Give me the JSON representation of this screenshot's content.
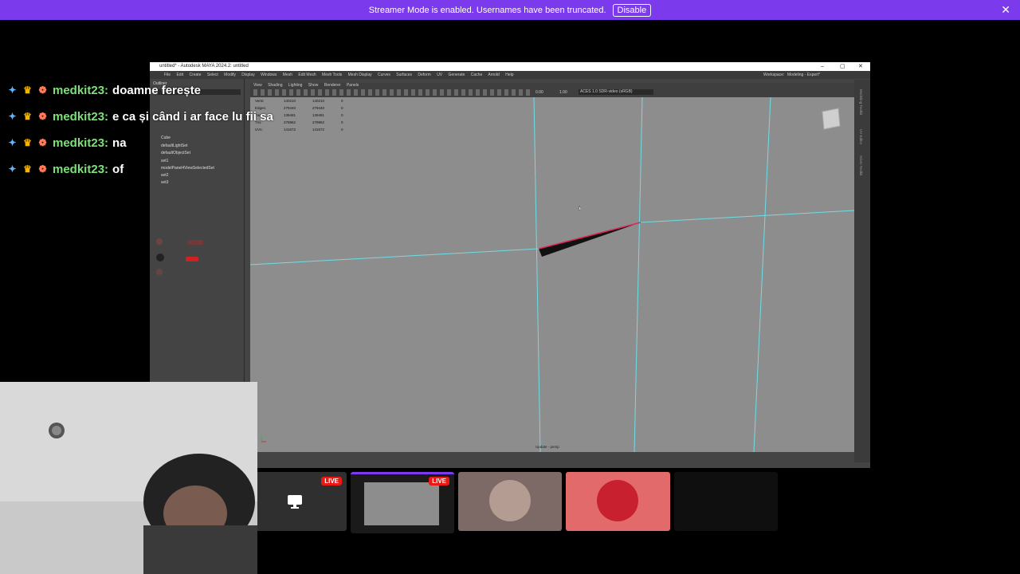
{
  "banner": {
    "message": "Streamer Mode is enabled. Usernames have been truncated.",
    "button": "Disable",
    "close": "✕"
  },
  "chat": [
    {
      "user": "medkit23:",
      "msg": "doamne ferește"
    },
    {
      "user": "medkit23:",
      "msg": "e ca și când i ar face lu fii sa"
    },
    {
      "user": "medkit23:",
      "msg": "na"
    },
    {
      "user": "medkit23:",
      "msg": "of"
    }
  ],
  "maya": {
    "title": "untitled* - Autodesk MAYA 2024.2: untitled",
    "menu": [
      "File",
      "Edit",
      "Create",
      "Select",
      "Modify",
      "Display",
      "Windows",
      "Mesh",
      "Edit Mesh",
      "Mesh Tools",
      "Mesh Display",
      "Curves",
      "Surfaces",
      "Deform",
      "UV",
      "Generate",
      "Cache",
      "Arnold",
      "Help"
    ],
    "workspace_label": "Workspace:",
    "workspace_value": "Modeling - Expert*",
    "outliner_title": "Outliner",
    "outliner_search": "Search...",
    "outliner_items": [
      "Cube",
      "defaultLightSet",
      "defaultObjectSet",
      "set1",
      "modelPanel4ViewSelectedSet",
      "set2",
      "set3"
    ],
    "panel_menu": [
      "View",
      "Shading",
      "Lighting",
      "Show",
      "Renderer",
      "Panels"
    ],
    "colorspace": "ACES 1.0 SDR-video (sRGB)",
    "field_a": "0.00",
    "field_b": "1.00",
    "hud": [
      {
        "label": "Verts:",
        "a": "140210",
        "b": "140210",
        "c": "0"
      },
      {
        "label": "Edges:",
        "a": "279440",
        "b": "279440",
        "c": "0"
      },
      {
        "label": "Faces:",
        "a": "139481",
        "b": "139481",
        "c": "0"
      },
      {
        "label": "Tris:",
        "a": "278962",
        "b": "278962",
        "c": "0"
      },
      {
        "label": "UVs:",
        "a": "141672",
        "b": "141672",
        "c": "0"
      }
    ],
    "viewport_label": "Update - persp",
    "side_tabs": [
      "Modeling Toolkit",
      "UV Editor",
      "XGen Toolkit"
    ]
  },
  "tiles": [
    {
      "live": "LIVE"
    },
    {
      "live": "LIVE"
    },
    {},
    {},
    {}
  ],
  "colors": {
    "banner": "#7c3aed",
    "live": "#e91916",
    "username": "#7ee07a",
    "edge_highlight": "#5fd8e0",
    "selected_edge": "#e0285a"
  }
}
